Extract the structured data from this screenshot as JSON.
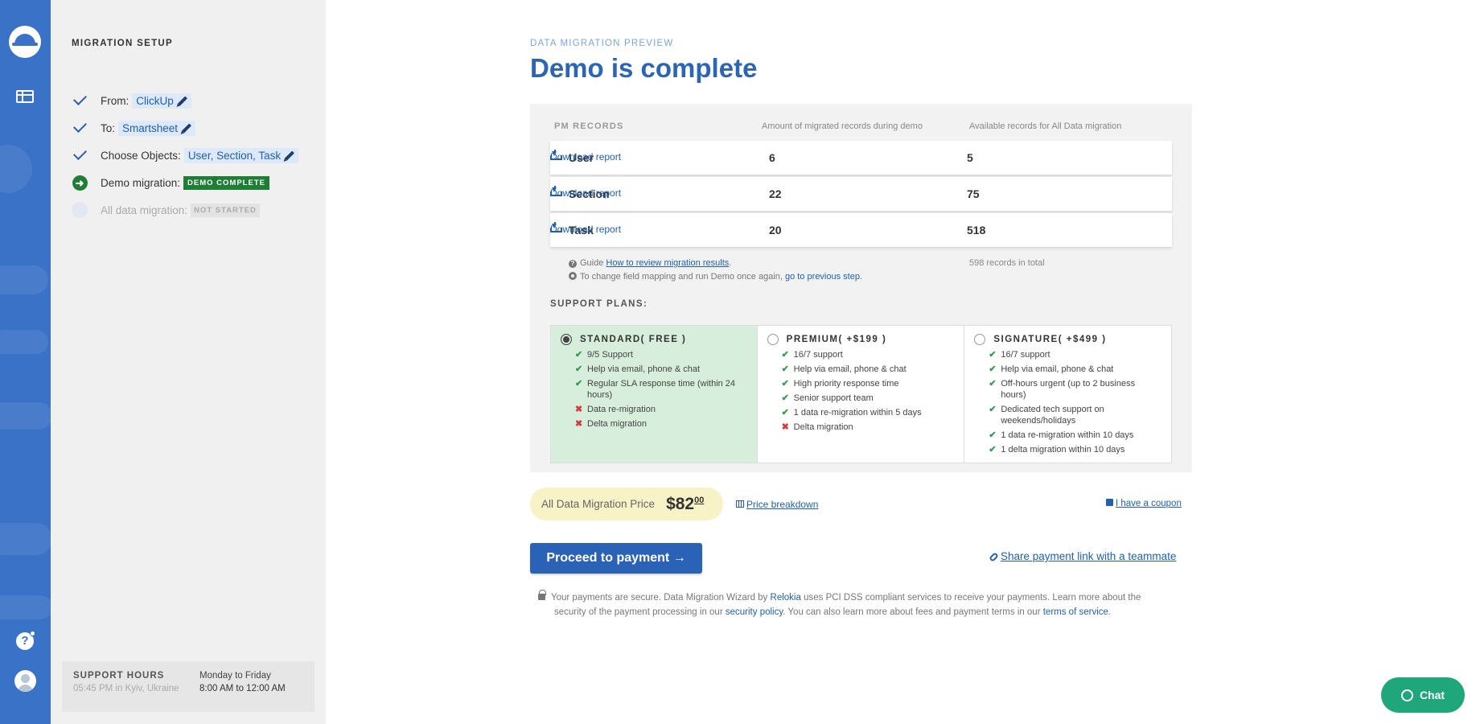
{
  "sidebar": {
    "title": "MIGRATION SETUP",
    "steps": [
      {
        "label": "From:",
        "value": "ClickUp"
      },
      {
        "label": "To:",
        "value": "Smartsheet"
      },
      {
        "label": "Choose Objects:",
        "value": "User, Section, Task"
      },
      {
        "label": "Demo migration:",
        "badge": "DEMO COMPLETE"
      },
      {
        "label": "All data migration:",
        "badge": "NOT STARTED"
      }
    ],
    "support_hours": {
      "title": "SUPPORT HOURS",
      "local_time": "05:45 PM in Kyiv, Ukraine",
      "days": "Monday to Friday",
      "hours": "8:00 AM to 12:00 AM"
    }
  },
  "header": {
    "eyebrow": "DATA MIGRATION PREVIEW",
    "title": "Demo is complete"
  },
  "records": {
    "title": "PM RECORDS",
    "col_demo": "Amount of migrated records during demo",
    "col_all": "Available records for All Data migration",
    "rows": [
      {
        "name": "User",
        "demo": "6",
        "link": "Download report",
        "available": "5"
      },
      {
        "name": "Section",
        "demo": "22",
        "link": "Download report",
        "available": "75"
      },
      {
        "name": "Task",
        "demo": "20",
        "link": "Download report",
        "available": "518"
      }
    ],
    "guide_prefix": "Guide",
    "guide_link": "How to review migration results",
    "guide_suffix": ".",
    "remap_text": "To change field mapping and run Demo once again,",
    "remap_link": "go to previous step",
    "remap_suffix": ".",
    "total": "598 records in total"
  },
  "support_plans": {
    "label": "SUPPORT PLANS:",
    "plans": [
      {
        "name": "STANDARD( FREE )",
        "selected": true,
        "features": [
          {
            "text": "9/5 Support",
            "included": true
          },
          {
            "text": "Help via email, phone & chat",
            "included": true
          },
          {
            "text": "Regular SLA response time (within 24 hours)",
            "included": true
          },
          {
            "text": "Data re-migration",
            "included": false
          },
          {
            "text": "Delta migration",
            "included": false
          }
        ]
      },
      {
        "name": "PREMIUM( +$199 )",
        "selected": false,
        "features": [
          {
            "text": "16/7 support",
            "included": true
          },
          {
            "text": "Help via email, phone & chat",
            "included": true
          },
          {
            "text": "High priority response time",
            "included": true
          },
          {
            "text": "Senior support team",
            "included": true
          },
          {
            "text": "1 data re-migration within 5 days",
            "included": true
          },
          {
            "text": "Delta migration",
            "included": false
          }
        ]
      },
      {
        "name": "SIGNATURE( +$499 )",
        "selected": false,
        "features": [
          {
            "text": "16/7 support",
            "included": true
          },
          {
            "text": "Help via email, phone & chat",
            "included": true
          },
          {
            "text": "Off-hours urgent (up to 2 business hours)",
            "included": true
          },
          {
            "text": "Dedicated tech support on weekends/holidays",
            "included": true
          },
          {
            "text": "1 data re-migration within 10 days",
            "included": true
          },
          {
            "text": "1 delta migration within 10 days",
            "included": true
          }
        ]
      }
    ]
  },
  "pricing": {
    "label": "All Data Migration Price",
    "amount": "$82",
    "cents": "00",
    "breakdown": "Price breakdown",
    "coupon": "I have a coupon"
  },
  "actions": {
    "pay": "Proceed to payment →",
    "share": "Share payment link with a teammate"
  },
  "security": {
    "t1": "Your payments are secure. Data Migration Wizard by",
    "brand": "Relokia",
    "t2": "uses PCI DSS compliant services to receive your payments. Learn more about the",
    "t3": "security of the payment processing in our",
    "policy": "security policy",
    "t4": ". You can also learn more about fees and payment terms in our",
    "terms": "terms of service",
    "t5": "."
  },
  "chat": {
    "label": "Chat"
  },
  "icons": {
    "logo": "relokia-logo",
    "table": "table-icon",
    "help": "help-icon",
    "avatar": "user-avatar-icon"
  },
  "colors": {
    "brand_blue": "#3a72c8",
    "title_blue": "#2a65b6",
    "success_green": "#1e7e34",
    "chat_green": "#1fa67a",
    "price_yellow": "#f8f3c7"
  }
}
